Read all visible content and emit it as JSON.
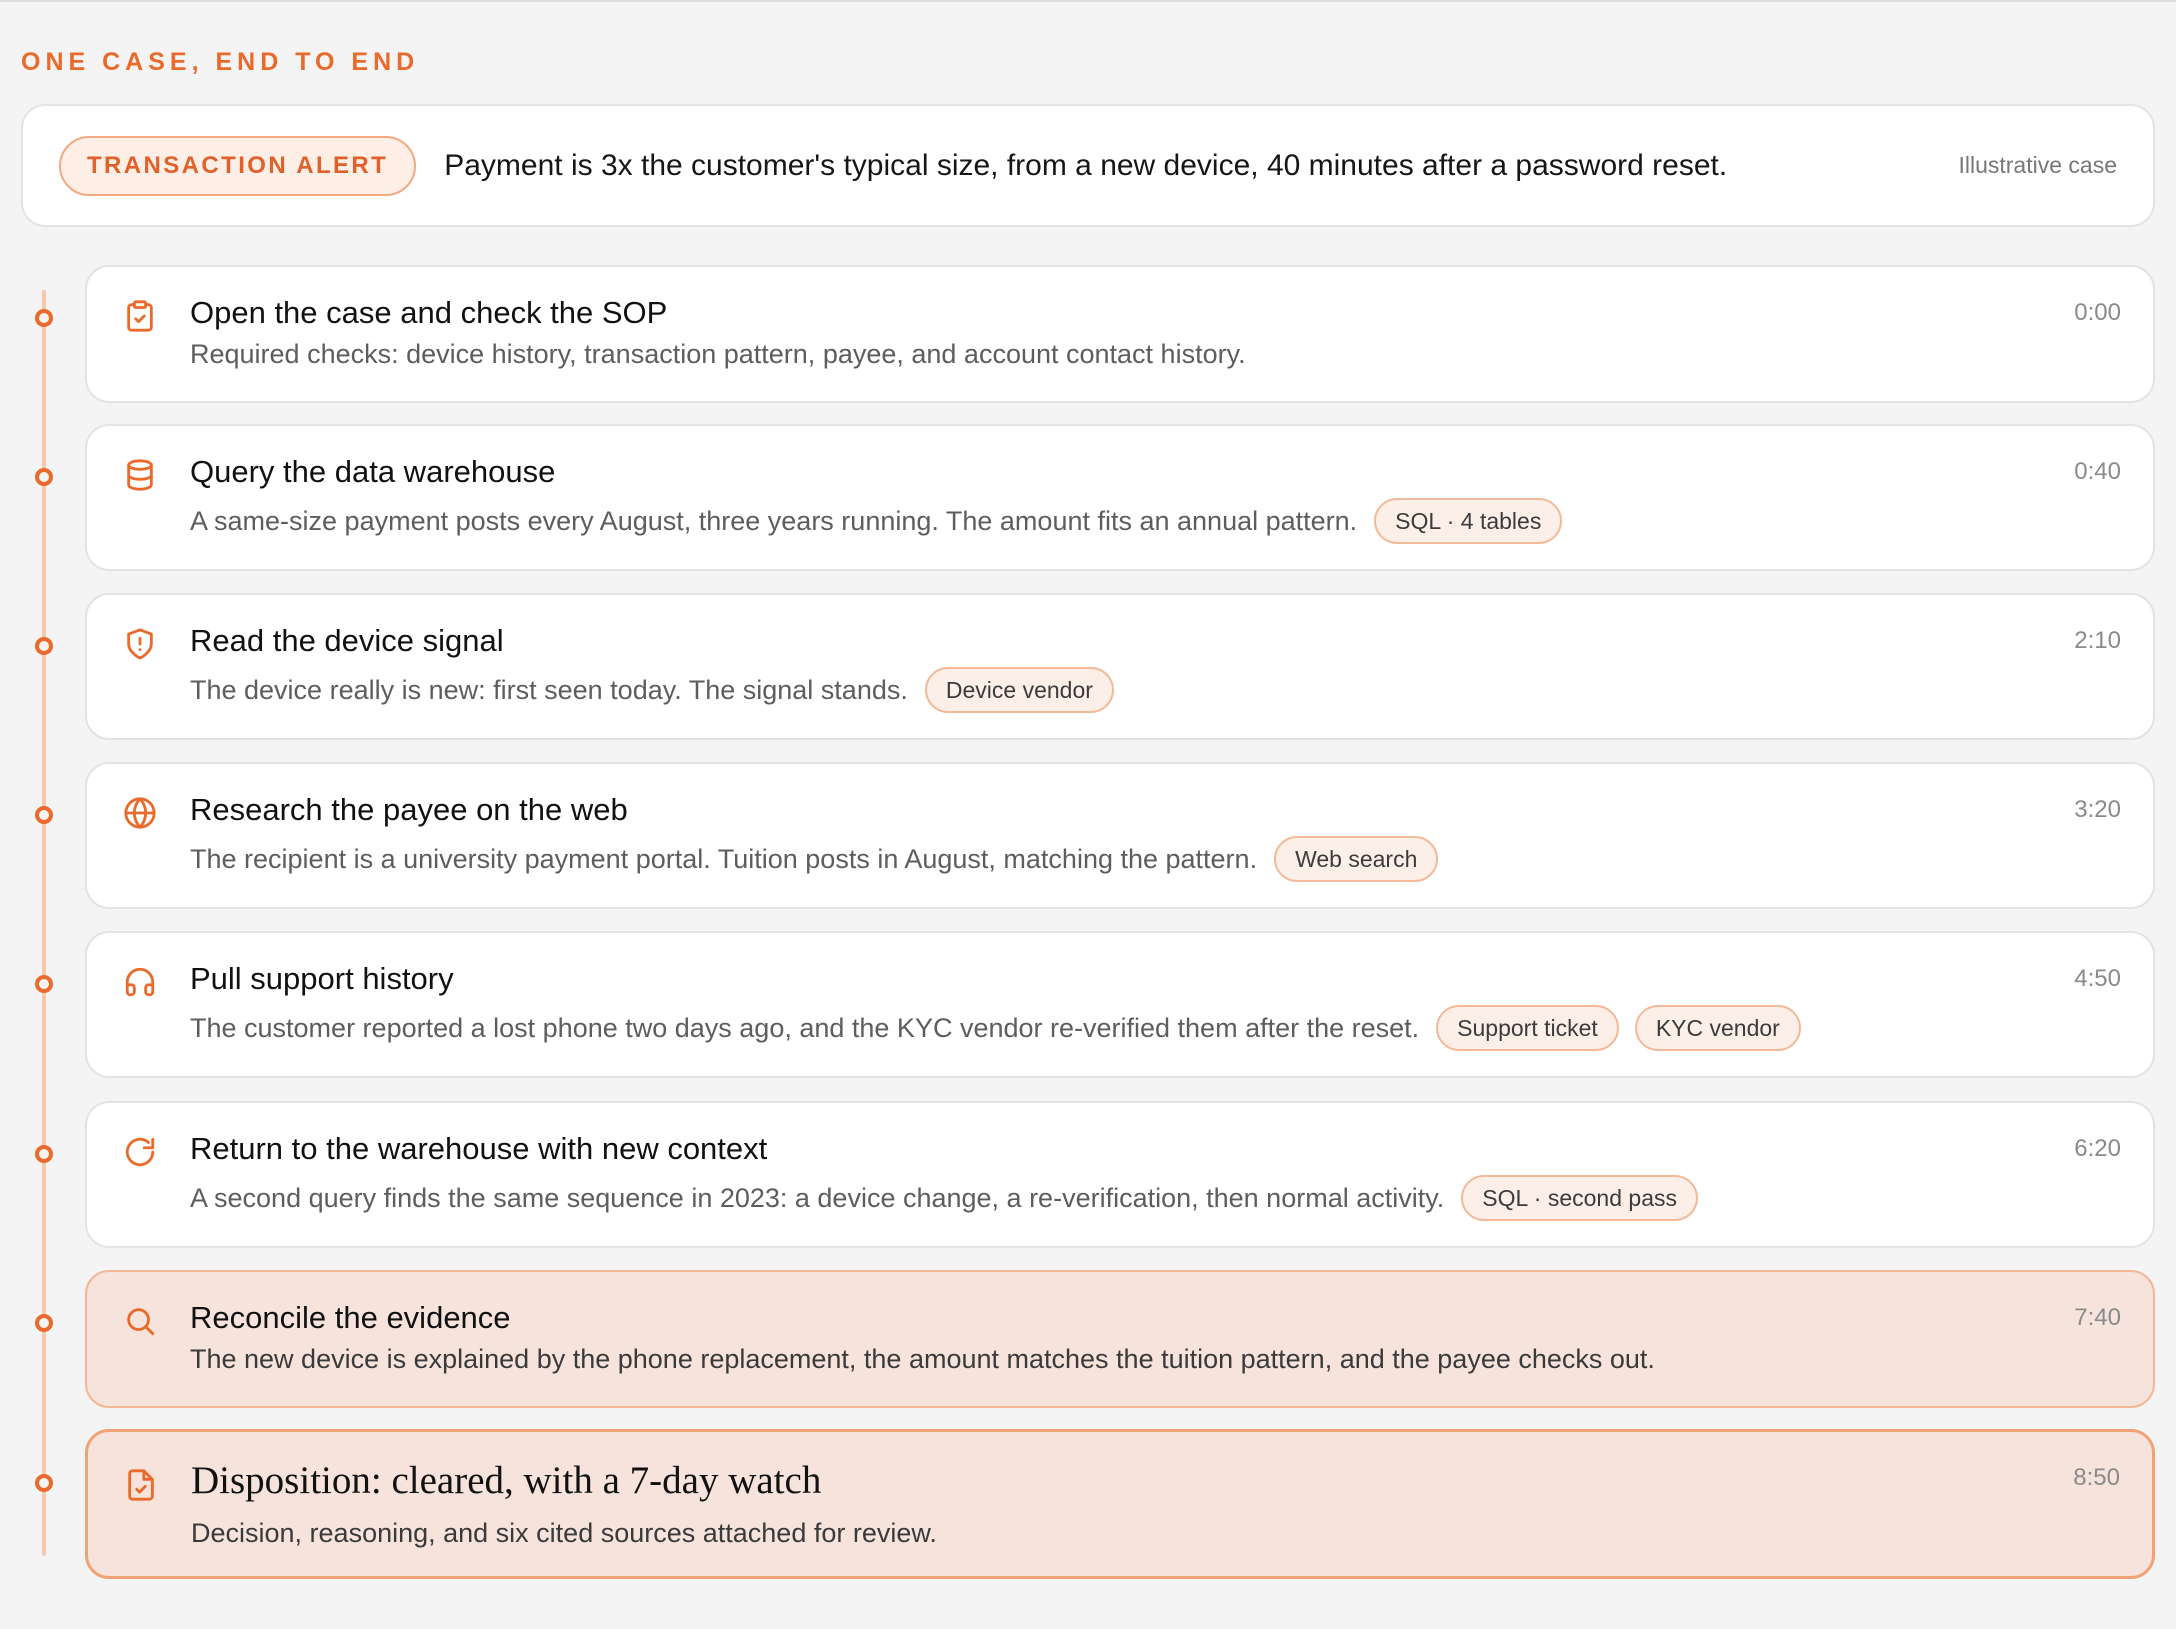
{
  "header": {
    "eyebrow": "ONE CASE, END TO END"
  },
  "alert": {
    "pill_label": "TRANSACTION ALERT",
    "text": "Payment is 3x the customer's typical size, from a new device, 40 minutes after a password reset.",
    "note": "Illustrative case"
  },
  "colors": {
    "accent": "#ea6a2c",
    "rail": "#f6c8ae",
    "highlight_bg": "#f6e4dc",
    "tag_border": "#f2ba99"
  },
  "steps": [
    {
      "icon": "clipboard-check-icon",
      "title": "Open the case and check the SOP",
      "description": "Required checks: device history, transaction pattern, payee, and account contact history.",
      "time": "0:00",
      "tags": []
    },
    {
      "icon": "database-icon",
      "title": "Query the data warehouse",
      "description": "A same-size payment posts every August, three years running. The amount fits an annual pattern.",
      "time": "0:40",
      "tags": [
        "SQL · 4 tables"
      ]
    },
    {
      "icon": "shield-alert-icon",
      "title": "Read the device signal",
      "description": "The device really is new: first seen today. The signal stands.",
      "time": "2:10",
      "tags": [
        "Device vendor"
      ]
    },
    {
      "icon": "globe-icon",
      "title": "Research the payee on the web",
      "description": "The recipient is a university payment portal. Tuition posts in August, matching the pattern.",
      "time": "3:20",
      "tags": [
        "Web search"
      ]
    },
    {
      "icon": "headset-icon",
      "title": "Pull support history",
      "description": "The customer reported a lost phone two days ago, and the KYC vendor re-verified them after the reset.",
      "time": "4:50",
      "tags": [
        "Support ticket",
        "KYC vendor"
      ]
    },
    {
      "icon": "refresh-icon",
      "title": "Return to the warehouse with new context",
      "description": "A second query finds the same sequence in 2023: a device change, a re-verification, then normal activity.",
      "time": "6:20",
      "tags": [
        "SQL · second pass"
      ]
    },
    {
      "icon": "search-icon",
      "title": "Reconcile the evidence",
      "description": "The new device is explained by the phone replacement, the amount matches the tuition pattern, and the payee checks out.",
      "time": "7:40",
      "tags": []
    },
    {
      "icon": "file-check-icon",
      "title": "Disposition: cleared, with a 7-day watch",
      "description": "Decision, reasoning, and six cited sources attached for review.",
      "time": "8:50",
      "tags": []
    }
  ]
}
